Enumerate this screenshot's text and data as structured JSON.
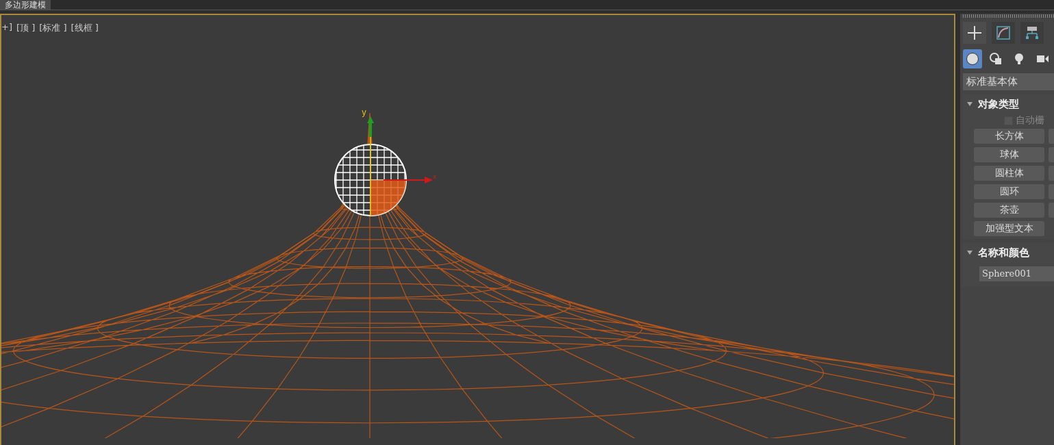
{
  "top_bar": {
    "tab": "多边形建模"
  },
  "viewport": {
    "labels": [
      "+]",
      "[顶 ]",
      "[标准 ]",
      "[线框 ]"
    ],
    "gizmo": {
      "y_label": "y",
      "x_label": "x"
    }
  },
  "command_panel": {
    "tabs": [
      {
        "kind": "create",
        "selected": true
      },
      {
        "kind": "modify",
        "selected": false
      },
      {
        "kind": "hierarchy",
        "selected": false
      }
    ],
    "categories": [
      {
        "kind": "geometry",
        "selected": true
      },
      {
        "kind": "shapes",
        "selected": false
      },
      {
        "kind": "lights",
        "selected": false
      },
      {
        "kind": "cameras",
        "selected": false
      }
    ],
    "dropdown": "标准基本体",
    "rollouts": [
      {
        "kind": "object_type",
        "title": "对象类型",
        "expanded": true,
        "checkbox": {
          "label": "自动栅",
          "checked": false
        },
        "buttons": [
          "长方体",
          "球体",
          "圆柱体",
          "圆环",
          "茶壶",
          "加强型文本"
        ]
      },
      {
        "kind": "name_color",
        "title": "名称和颜色",
        "expanded": true,
        "name_value": "Sphere001"
      }
    ]
  }
}
